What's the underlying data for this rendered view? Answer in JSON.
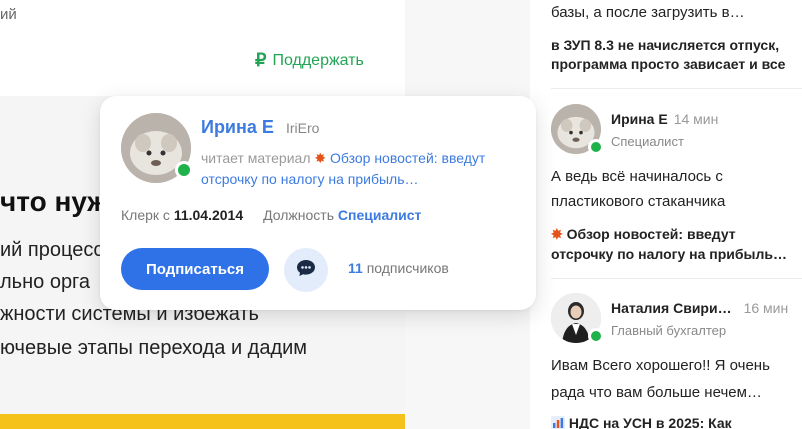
{
  "article": {
    "top_cut": "ий",
    "support_label": "Поддержать",
    "support_icon": "ruble-icon",
    "heading": "что нуж",
    "paragraph_lines": [
      "ий процесс",
      "льно орга",
      "жности системы и избежать",
      "ючевые этапы перехода и дадим"
    ]
  },
  "popover": {
    "author_name": "Ирина Е",
    "author_nick": "IriEro",
    "reading_label": "читает материал",
    "reading_link": "Обзор новостей: введут отсрочку по налогу на прибыль…",
    "since_label": "Клерк с",
    "since_date": "11.04.2014",
    "position_label": "Должность",
    "position_value": "Специалист",
    "subscribe_label": "Подписаться",
    "subscribers_count": "11",
    "subscribers_label": "подписчиков"
  },
  "feed": {
    "top_line": "базы, а после загрузить в…",
    "thread_title_1": "в ЗУП 8.3 не начисляется отпуск,",
    "thread_title_2": "программа просто зависает и все",
    "comments": [
      {
        "user": "Ирина Е",
        "time": "14 мин",
        "role": "Специалист",
        "text_1": "А ведь всё начиналось с",
        "text_2": "пластикового стаканчика",
        "link_1": "Обзор новостей: введут",
        "link_2": "отсрочку по налогу на прибыль…"
      },
      {
        "user": "Наталия Свири…",
        "time": "16 мин",
        "role": "Главный бухгалтер",
        "text_1": "Ивам Всего хорошего!! Я очень",
        "text_2": "рада что вам больше нечем…",
        "link_1": "НДС на УСН в 2025: Как"
      }
    ]
  },
  "colors": {
    "accent_blue": "#2f72e8",
    "link_blue": "#3d7be0",
    "online_green": "#20b24a",
    "support_green": "#23a455"
  }
}
